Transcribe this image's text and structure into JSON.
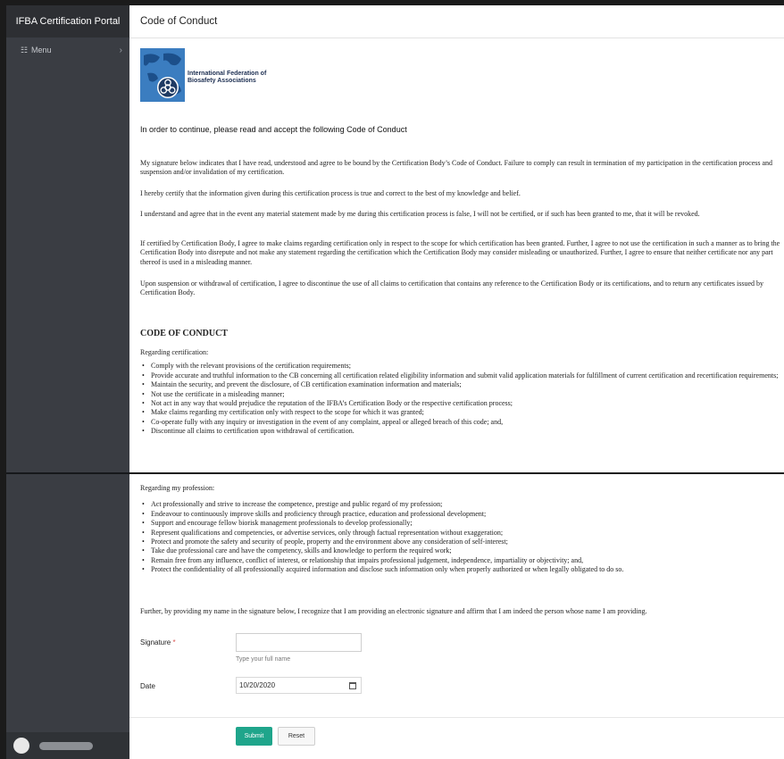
{
  "sidebar": {
    "brand": "IFBA Certification Portal",
    "menu_label": "Menu",
    "menu_icon": "list-icon",
    "chevron_icon": "chevron-right-icon"
  },
  "header": {
    "title": "Code of Conduct"
  },
  "logo": {
    "line1": "International Federation of",
    "line2": "Biosafety Associations"
  },
  "intro": "In order to continue, please read and accept the following Code of Conduct",
  "paragraphs": [
    "My signature below indicates that I have read, understood and agree to be bound by the Certification Body’s Code of Conduct. Failure to comply can result in termination of my participation in the certification process and suspension and/or invalidation of my certification.",
    "I hereby certify that the information given during this certification process is true and correct to the best of my knowledge and belief.",
    "I understand and agree that in the event any material statement made by me during this certification process is false, I will not be certified, or if such has been granted to me, that it will be revoked.",
    "If certified by Certification Body, I agree to make claims regarding certification only in respect to the scope for which certification has been granted. Further, I agree to not use the certification in such a manner as to bring the Certification Body into disrepute and not make any statement regarding the certification which the Certification Body may consider misleading or unauthorized. Further, I agree to ensure that neither certificate nor any part thereof is used in a misleading manner.",
    "Upon suspension or withdrawal of certification, I agree to discontinue the use of all claims to certification that contains any reference to the Certification Body or its certifications, and to return any certificates issued by Certification Body."
  ],
  "coc": {
    "heading": "CODE OF CONDUCT",
    "cert_label": "Regarding certification:",
    "cert_items": [
      "Comply with the relevant provisions of the certification requirements;",
      "Provide accurate and truthful information to the CB concerning all certification related eligibility information and submit valid application materials for fulfillment of current certification and recertification requirements;",
      "Maintain the security, and prevent the disclosure, of CB certification examination information and materials;",
      "Not use the certificate in a misleading manner;",
      "Not act in any way that would prejudice the reputation of the IFBA’s Certification Body or the respective certification process;",
      "Make claims regarding my certification only with respect to the scope for which it was granted;",
      "Co-operate fully with any inquiry or investigation in the event of any complaint, appeal or alleged breach of this code; and,",
      "Discontinue all claims to certification upon withdrawal of certification."
    ],
    "prof_label": "Regarding my profession:",
    "prof_items": [
      "Act professionally and strive to increase the competence, prestige and public regard of my profession;",
      "Endeavour to continuously improve skills and proficiency through practice, education and professional development;",
      "Support and encourage fellow biorisk management professionals to develop professionally;",
      "Represent qualifications and competencies, or advertise services, only through factual representation without exaggeration;",
      "Protect and promote the safety and security of people, property and the environment above any consideration of self-interest;",
      "Take due professional care and have the competency, skills and knowledge to perform the required work;",
      "Remain free from any influence, conflict of interest, or relationship that impairs professional judgement, independence, impartiality or objectivity;  and,",
      "Protect the confidentiality of all professionally acquired information and disclose such information only when properly authorized or when legally obligated to do so."
    ],
    "closing": "Further, by providing my name in the signature below, I recognize that I am providing an electronic signature and affirm that I am indeed the person whose name I am providing."
  },
  "form": {
    "signature_label": "Signature",
    "required_mark": "*",
    "signature_value": "",
    "signature_hint": "Type your full name",
    "date_label": "Date",
    "date_value": "10/20/2020",
    "date_icon": "calendar-icon",
    "submit_label": "Submit",
    "reset_label": "Reset"
  },
  "colors": {
    "sidebar_bg": "#3a3d43",
    "submit_bg": "#1fa58b",
    "required": "#d9534f"
  }
}
